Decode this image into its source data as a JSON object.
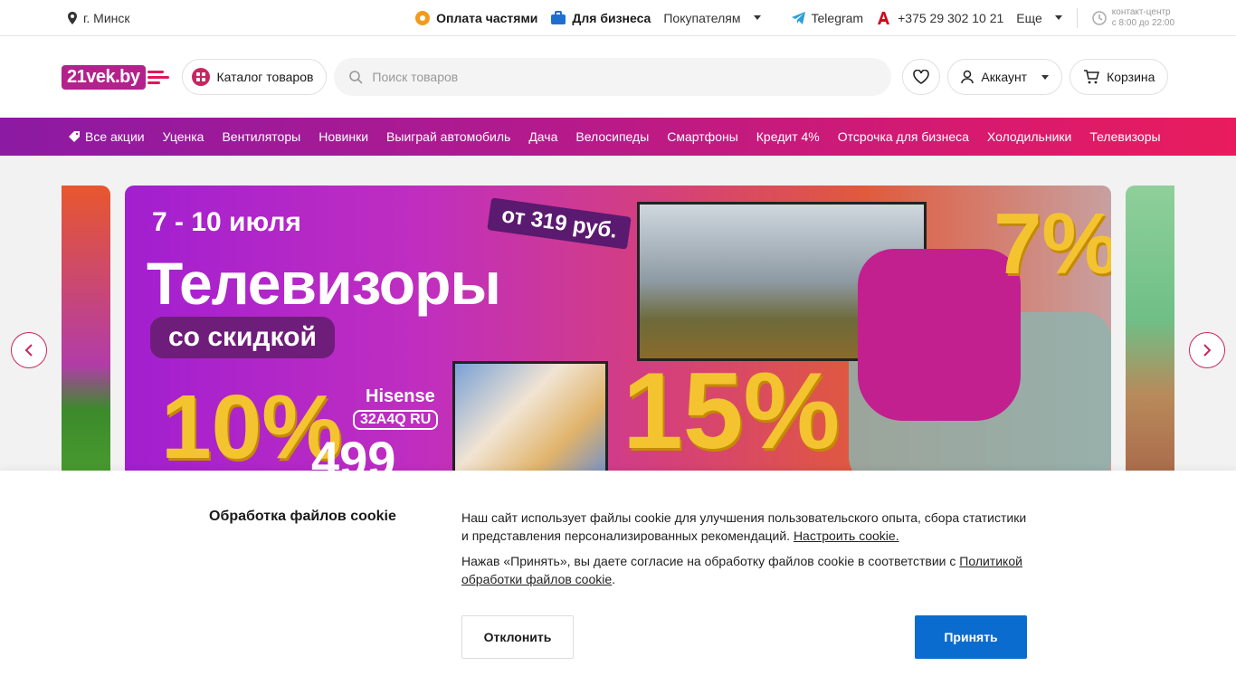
{
  "topbar": {
    "city": "г. Минск",
    "installments": "Оплата частями",
    "business": "Для бизнеса",
    "buyers": "Покупателям",
    "telegram": "Telegram",
    "phone": "+375 29 302 10 21",
    "more": "Еще",
    "contact_title": "контакт-центр",
    "contact_hours": "с 8:00 до 22:00"
  },
  "header": {
    "logo_text": "21vek.by",
    "catalog_label": "Каталог товаров",
    "search_placeholder": "Поиск товаров",
    "account_label": "Аккаунт",
    "cart_label": "Корзина"
  },
  "promo_nav": {
    "items": [
      "Все акции",
      "Уценка",
      "Вентиляторы",
      "Новинки",
      "Выиграй автомобиль",
      "Дача",
      "Велосипеды",
      "Смартфоны",
      "Кредит 4%",
      "Отсрочка для бизнеса",
      "Холодильники",
      "Телевизоры"
    ]
  },
  "banner": {
    "date": "7 - 10 июля",
    "title": "Телевизоры",
    "subtitle": "со скидкой",
    "price_from": "от 319 руб.",
    "brand": "Hisense",
    "model": "32A4Q RU",
    "price": "499",
    "discount_1": "10%",
    "discount_2": "15%",
    "discount_3": "7%"
  },
  "cookie": {
    "title": "Обработка файлов cookie",
    "text_1": "Наш сайт использует файлы cookie для улучшения пользовательского опыта, сбора статистики и представления персонализированных рекомендаций.",
    "link_settings": "Настроить cookie.",
    "text_2": "Нажав «Принять», вы даете согласие на обработку файлов cookie в соответствии с",
    "link_policy": "Политикой обработки файлов cookie",
    "decline": "Отклонить",
    "accept": "Принять"
  },
  "colors": {
    "brand": "#c7265f",
    "accept_button": "#0a6ccf"
  }
}
